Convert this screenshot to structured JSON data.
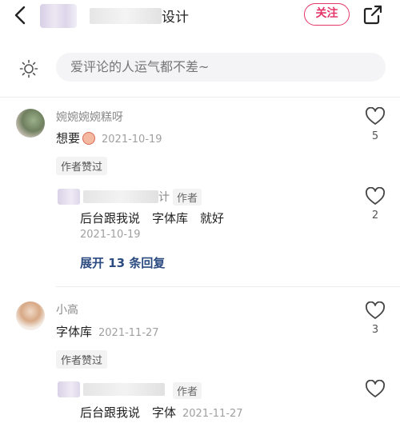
{
  "header": {
    "author_name_tail": "设计",
    "follow_label": "关注"
  },
  "comment_input": {
    "placeholder": "爱评论的人运气都不差~"
  },
  "comments": [
    {
      "username": "婉婉婉婉糕呀",
      "content": "想要",
      "date": "2021-10-19",
      "likes": "5",
      "author_liked_tag": "作者赞过",
      "reply": {
        "name_tail": "计",
        "author_tag": "作者",
        "content": "后台跟我说　字体库　就好",
        "date": "2021-10-19",
        "likes": "2"
      },
      "expand_label": "展开 13 条回复"
    },
    {
      "username": "小高",
      "content": "字体库",
      "date": "2021-11-27",
      "likes": "3",
      "author_liked_tag": "作者赞过",
      "reply": {
        "author_tag": "作者",
        "content": "后台跟我说　字体",
        "date": "2021-11-27"
      }
    }
  ],
  "colors": {
    "accent": "#e5366a",
    "link": "#2b4a80"
  }
}
